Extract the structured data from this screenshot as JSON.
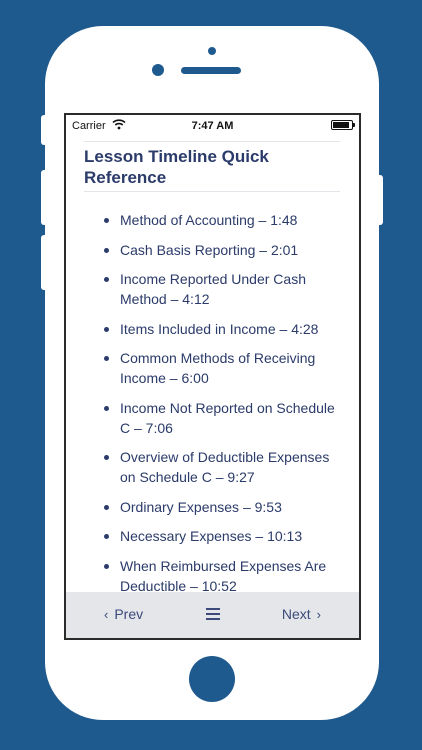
{
  "status_bar": {
    "carrier": "Carrier",
    "time": "7:47 AM",
    "battery_level": 0.9
  },
  "header": {
    "title": "Lesson Timeline Quick Reference"
  },
  "timeline": [
    "Method of Accounting – 1:48",
    "Cash Basis Reporting – 2:01",
    "Income Reported Under Cash Method – 4:12",
    "Items Included in Income – 4:28",
    "Common Methods of Receiving Income – 6:00",
    "Income Not Reported on Schedule C – 7:06",
    "Overview of Deductible Expenses on Schedule C  – 9:27",
    "Ordinary Expenses – 9:53",
    "Necessary Expenses – 10:13",
    "When Reimbursed Expenses Are Deductible – 10:52"
  ],
  "toolbar": {
    "prev_label": "Prev",
    "next_label": "Next",
    "menu_icon": "hamburger-menu-icon"
  },
  "colors": {
    "background": "#1f5a8f",
    "text": "#2b3b6a",
    "toolbar": "#e4e6ea"
  }
}
